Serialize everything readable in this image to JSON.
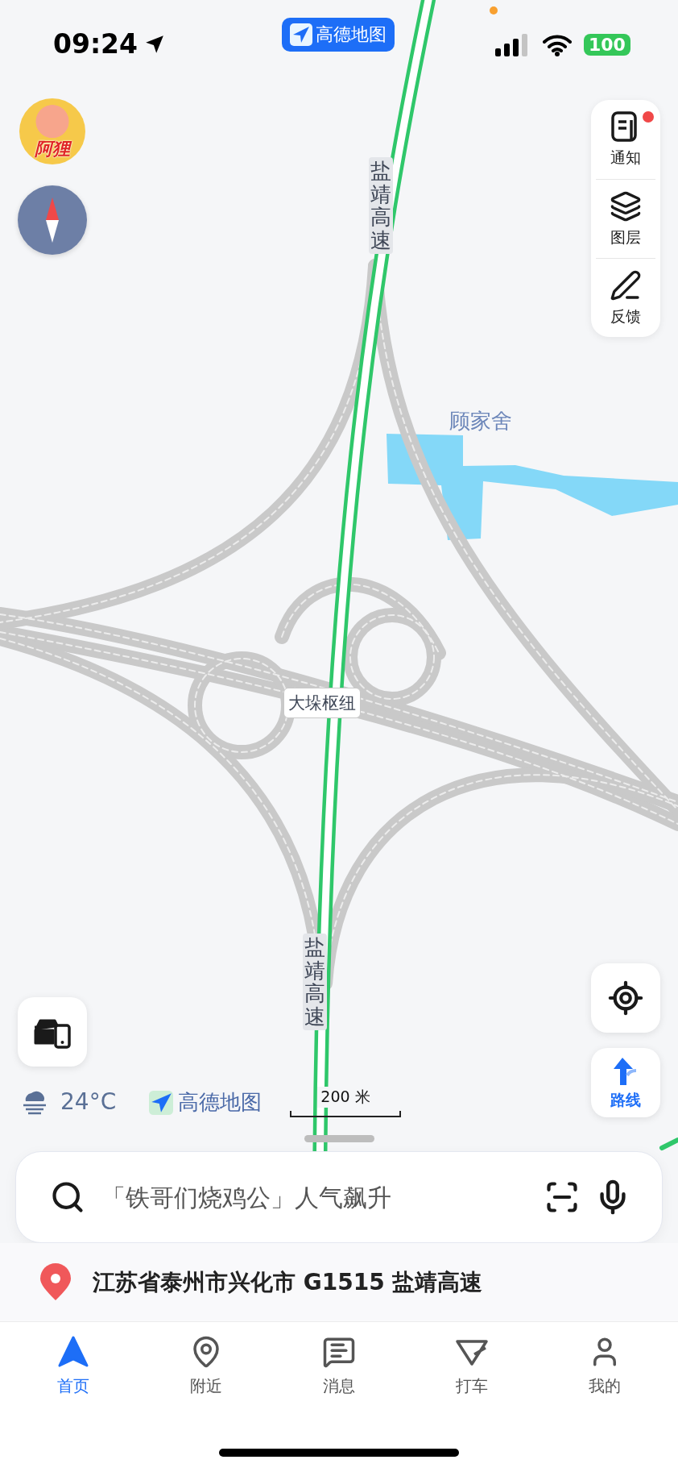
{
  "status_bar": {
    "time": "09:24",
    "app_badge": "高德地图",
    "battery": "100"
  },
  "avatar": {
    "label": "阿狸"
  },
  "side_panel": [
    {
      "label": "通知",
      "kind": "notice",
      "badge": true
    },
    {
      "label": "图层",
      "kind": "layers",
      "badge": false
    },
    {
      "label": "反馈",
      "kind": "feedback",
      "badge": false
    }
  ],
  "map": {
    "labels": [
      {
        "text": "盐靖高速",
        "kind": "road"
      },
      {
        "text": "顾家舍",
        "kind": "place"
      },
      {
        "text": "大垛枢纽",
        "kind": "junction"
      },
      {
        "text": "盐靖高速",
        "kind": "road"
      }
    ]
  },
  "route_button": {
    "label": "路线"
  },
  "weather": {
    "temperature": "24°C"
  },
  "brand": {
    "name": "高德地图"
  },
  "scale": {
    "label": "200 米"
  },
  "search": {
    "placeholder": "「铁哥们烧鸡公」人气飙升"
  },
  "address": {
    "text": "江苏省泰州市兴化市 G1515 盐靖高速"
  },
  "tabs": [
    {
      "label": "首页",
      "kind": "home",
      "selected": true
    },
    {
      "label": "附近",
      "kind": "nearby",
      "selected": false
    },
    {
      "label": "消息",
      "kind": "messages",
      "selected": false
    },
    {
      "label": "打车",
      "kind": "taxi",
      "selected": false
    },
    {
      "label": "我的",
      "kind": "me",
      "selected": false
    }
  ]
}
